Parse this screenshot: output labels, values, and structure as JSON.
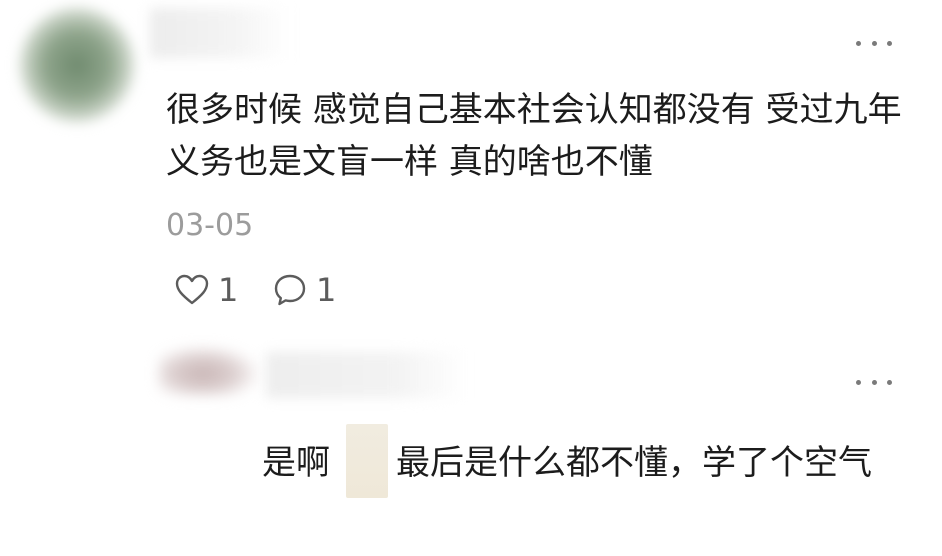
{
  "comment": {
    "text": "很多时候 感觉自己基本社会认知都没有 受过九年义务也是文盲一样 真的啥也不懂",
    "date": "03-05",
    "like_count": "1",
    "reply_count": "1",
    "icons": {
      "more": "more-dots-icon",
      "like": "heart-outline-icon",
      "reply": "speech-bubble-icon"
    }
  },
  "reply": {
    "text_before": "是啊",
    "text_after": "最后是什么都不懂，学了个空气",
    "icons": {
      "more": "more-dots-icon"
    }
  },
  "colors": {
    "text": "#1c1c1c",
    "meta": "#9c9c9c",
    "icon": "#5c5c5c"
  }
}
